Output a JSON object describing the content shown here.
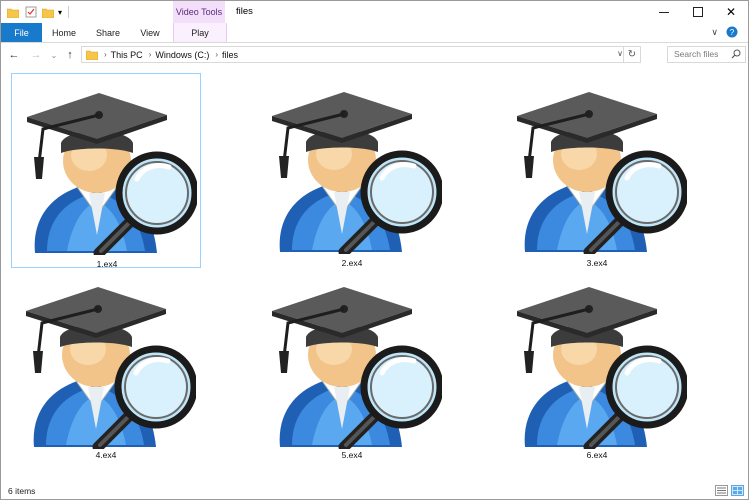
{
  "window": {
    "title": "files"
  },
  "ribbon": {
    "context_group": "Video Tools",
    "tabs": [
      "File",
      "Home",
      "Share",
      "View",
      "Play"
    ]
  },
  "address": {
    "crumbs": [
      "This PC",
      "Windows (C:)",
      "files"
    ]
  },
  "search": {
    "placeholder": "Search files"
  },
  "files": [
    {
      "name": "1.ex4",
      "selected": true
    },
    {
      "name": "2.ex4",
      "selected": false
    },
    {
      "name": "3.ex4",
      "selected": false
    },
    {
      "name": "4.ex4",
      "selected": false
    },
    {
      "name": "5.ex4",
      "selected": false
    },
    {
      "name": "6.ex4",
      "selected": false
    }
  ],
  "status": {
    "item_count": "6 items"
  },
  "colors": {
    "file_tab": "#1979ca",
    "video_tools": "#f4dffb",
    "selection_border": "#99d1ff"
  }
}
